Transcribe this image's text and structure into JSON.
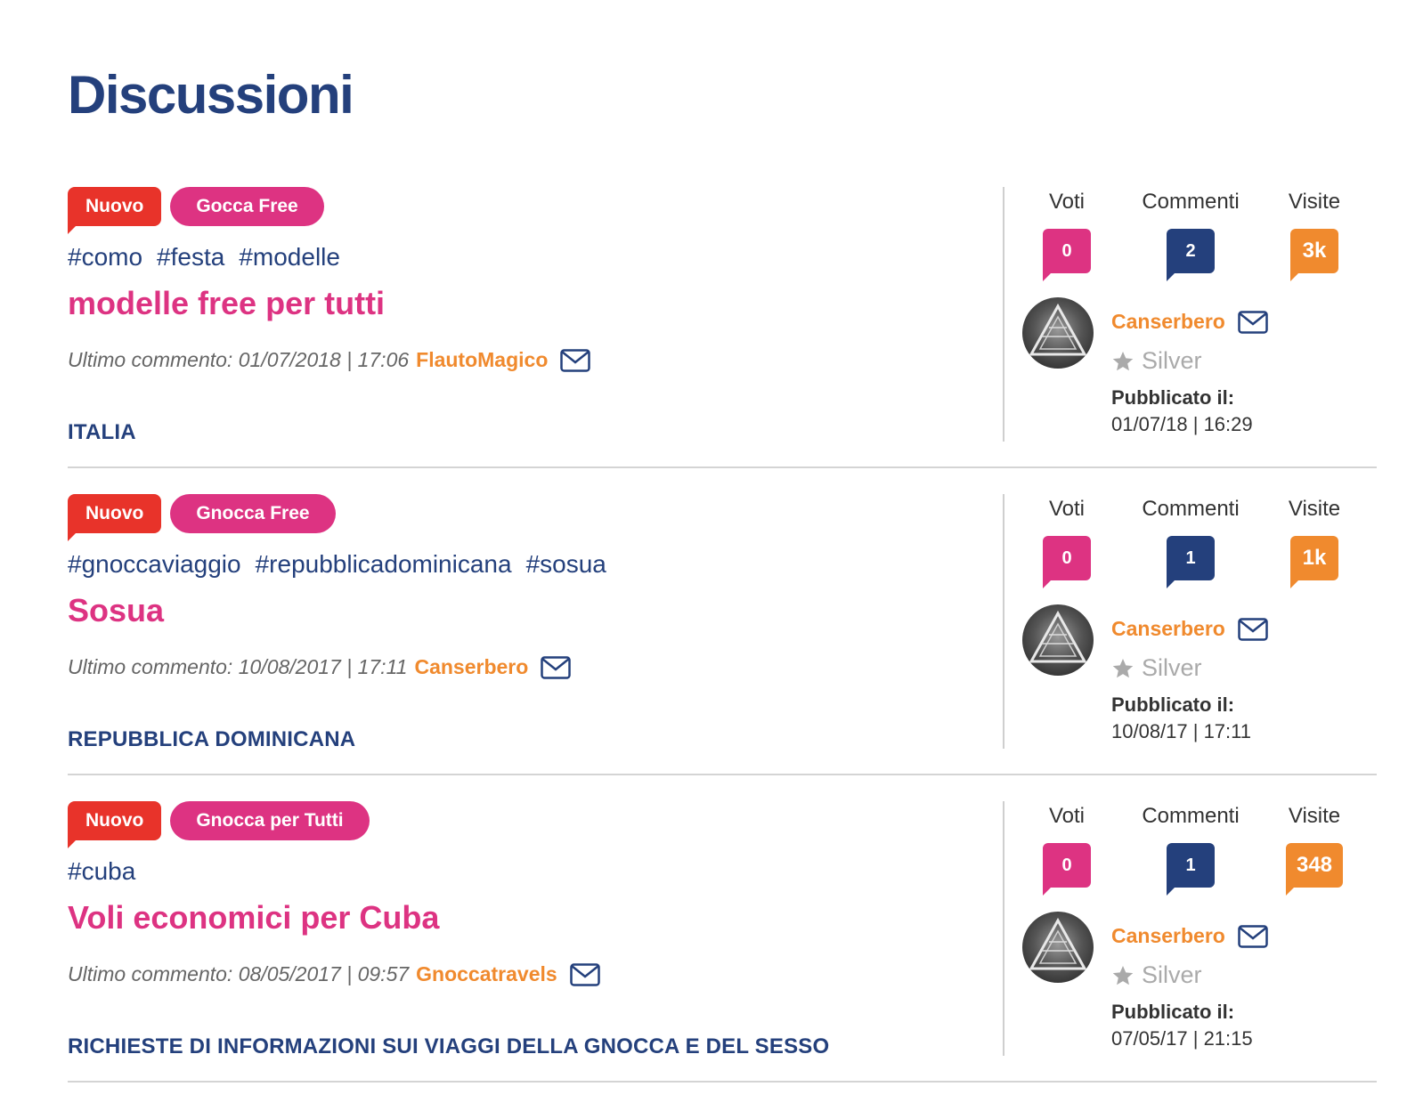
{
  "page": {
    "title": "Discussioni"
  },
  "labels": {
    "last_comment": "Ultimo commento:",
    "votes": "Voti",
    "comments": "Commenti",
    "visits": "Visite",
    "published": "Pubblicato il:"
  },
  "colors": {
    "navy": "#24407c",
    "pink": "#dd3382",
    "orange": "#f08a2e",
    "red": "#e8332a"
  },
  "threads": [
    {
      "badge_new": "Nuovo",
      "category": "Gocca Free",
      "tags": [
        "#como",
        "#festa",
        "#modelle"
      ],
      "title": "modelle free per tutti",
      "last_comment_date": "01/07/2018",
      "last_comment_time": "| 17:06",
      "last_comment_user": "FlautoMagico",
      "section": "ITALIA",
      "votes": "0",
      "comments": "2",
      "visits": "3k",
      "author": "Canserbero",
      "rank": "Silver",
      "published": "01/07/18 | 16:29"
    },
    {
      "badge_new": "Nuovo",
      "category": "Gnocca Free",
      "tags": [
        "#gnoccaviaggio",
        "#repubblicadominicana",
        "#sosua"
      ],
      "title": "Sosua",
      "last_comment_date": "10/08/2017",
      "last_comment_time": "| 17:11",
      "last_comment_user": "Canserbero",
      "section": "REPUBBLICA DOMINICANA",
      "votes": "0",
      "comments": "1",
      "visits": "1k",
      "author": "Canserbero",
      "rank": "Silver",
      "published": "10/08/17 | 17:11"
    },
    {
      "badge_new": "Nuovo",
      "category": "Gnocca per Tutti",
      "tags": [
        "#cuba"
      ],
      "title": "Voli economici per Cuba",
      "last_comment_date": "08/05/2017",
      "last_comment_time": "| 09:57",
      "last_comment_user": "Gnoccatravels",
      "section": "RICHIESTE DI INFORMAZIONI SUI VIAGGI DELLA GNOCCA E DEL SESSO",
      "votes": "0",
      "comments": "1",
      "visits": "348",
      "author": "Canserbero",
      "rank": "Silver",
      "published": "07/05/17 | 21:15"
    }
  ]
}
